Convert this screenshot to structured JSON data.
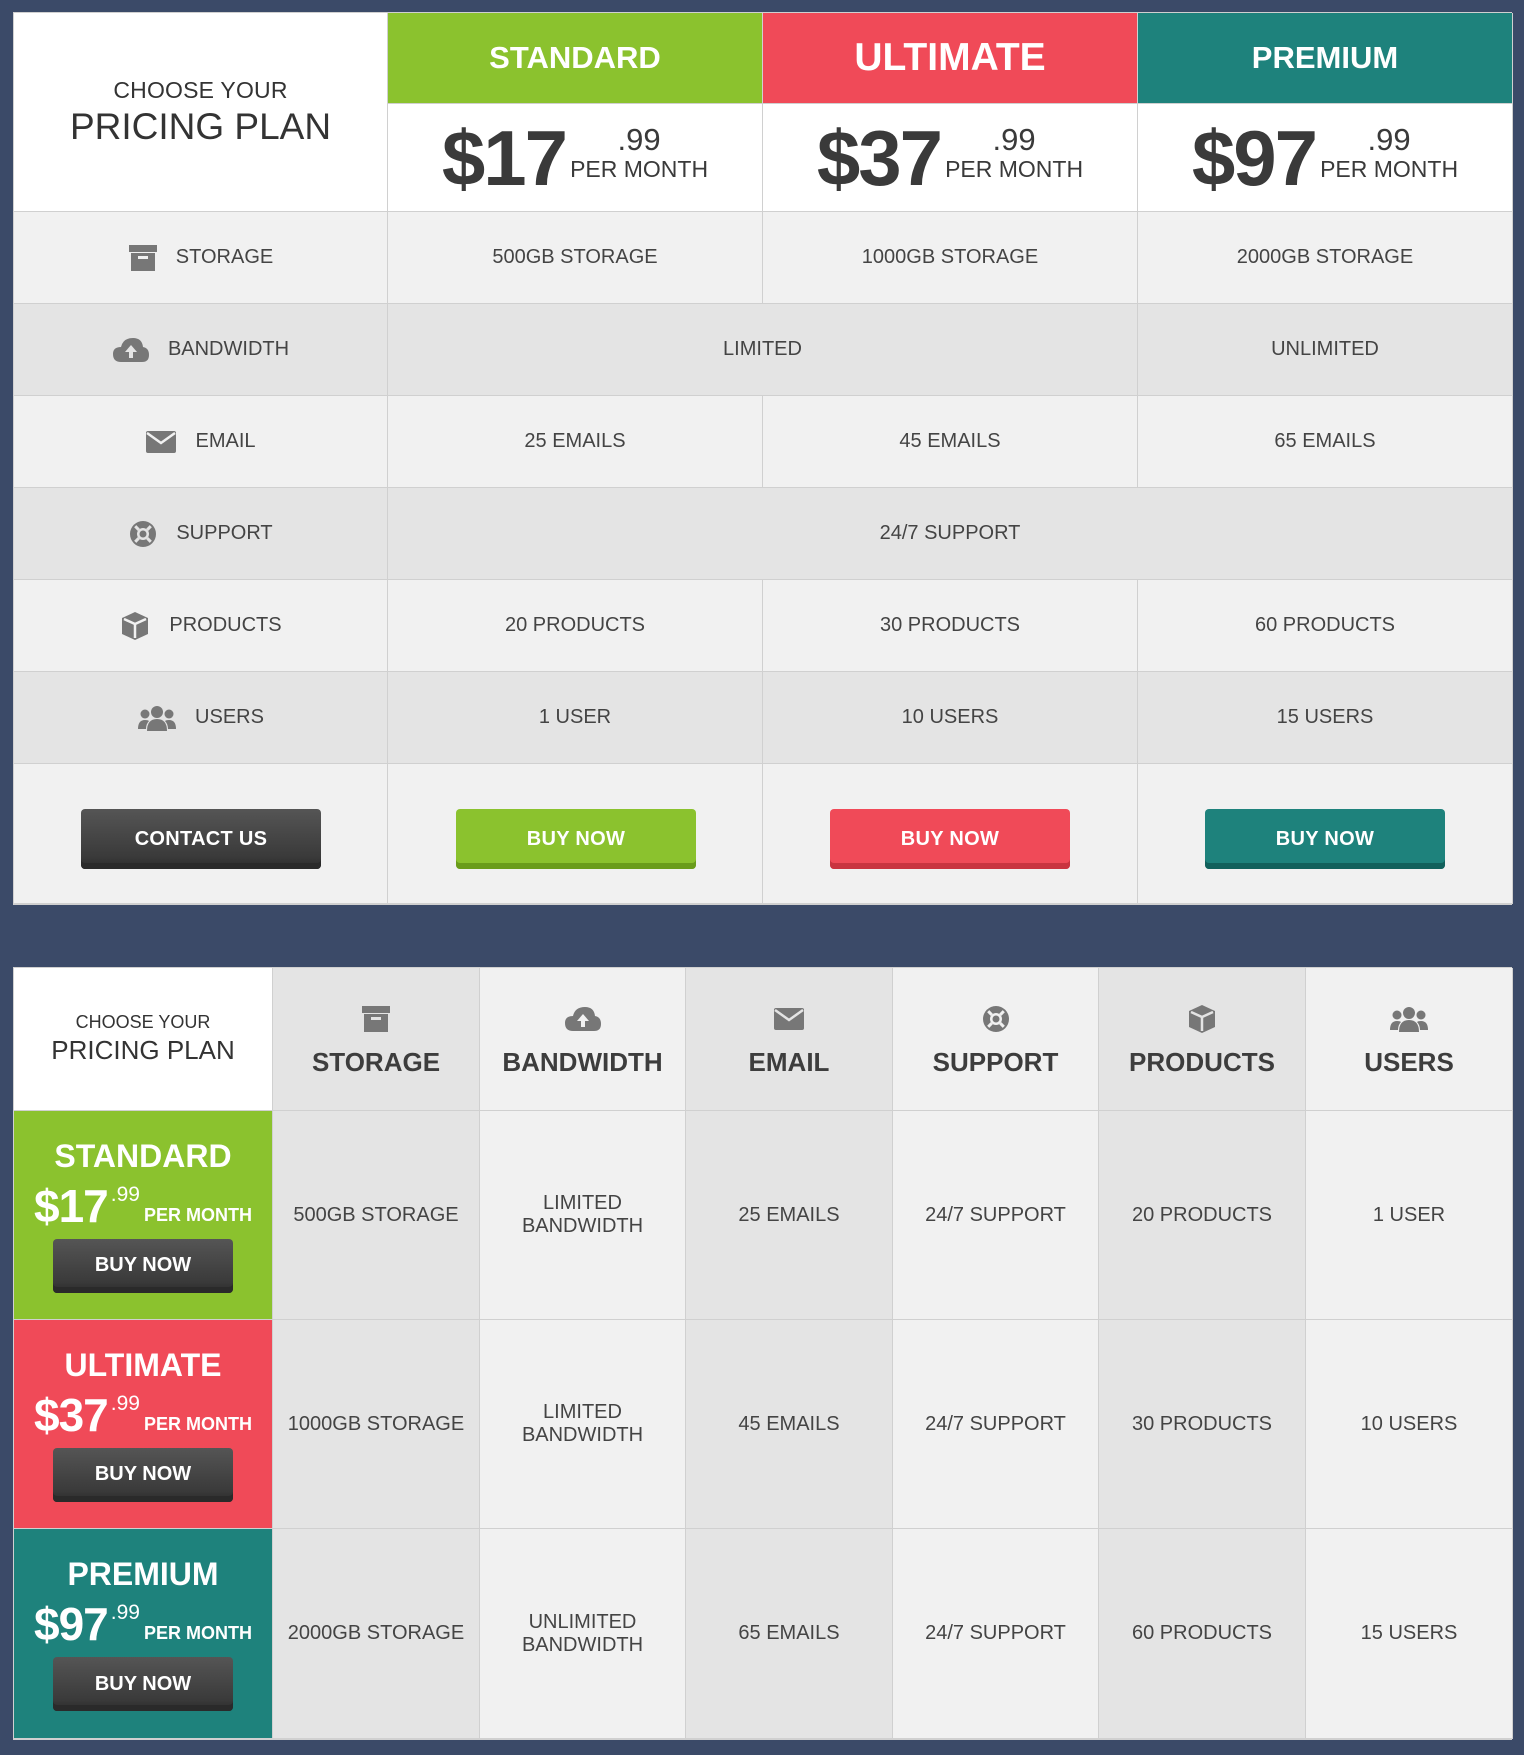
{
  "intro": {
    "top": "CHOOSE YOUR",
    "bottom": "PRICING PLAN"
  },
  "plans": [
    {
      "name": "STANDARD",
      "dollars": "$17",
      "cents": ".99",
      "per": "PER MONTH",
      "color": "#8bc22e",
      "button": "BUY NOW",
      "side_button": "BUY NOW",
      "values": {
        "storage": "500GB STORAGE",
        "email": "25 EMAILS",
        "products": "20 PRODUCTS",
        "users": "1 USER",
        "bandwidth2": "LIMITED BANDWIDTH",
        "support2": "24/7 SUPPORT"
      }
    },
    {
      "name": "ULTIMATE",
      "dollars": "$37",
      "cents": ".99",
      "per": "PER MONTH",
      "color": "#f04a58",
      "button": "BUY NOW",
      "side_button": "BUY NOW",
      "values": {
        "storage": "1000GB STORAGE",
        "email": "45 EMAILS",
        "products": "30 PRODUCTS",
        "users": "10 USERS",
        "bandwidth2": "LIMITED BANDWIDTH",
        "support2": "24/7 SUPPORT"
      }
    },
    {
      "name": "PREMIUM",
      "dollars": "$97",
      "cents": ".99",
      "per": "PER MONTH",
      "color": "#1e827c",
      "button": "BUY NOW",
      "side_button": "BUY NOW",
      "values": {
        "storage": "2000GB STORAGE",
        "email": "65 EMAILS",
        "products": "60 PRODUCTS",
        "users": "15 USERS",
        "bandwidth2": "UNLIMITED BANDWIDTH",
        "support2": "24/7 SUPPORT"
      }
    }
  ],
  "features": {
    "storage": {
      "label": "STORAGE",
      "icon": "archive-icon"
    },
    "bandwidth": {
      "label": "BANDWIDTH",
      "icon": "cloud-upload-icon"
    },
    "email": {
      "label": "EMAIL",
      "icon": "envelope-icon"
    },
    "support": {
      "label": "SUPPORT",
      "icon": "life-ring-icon"
    },
    "products": {
      "label": "PRODUCTS",
      "icon": "cube-icon"
    },
    "users": {
      "label": "USERS",
      "icon": "users-icon"
    }
  },
  "merged": {
    "bandwidth_limited": "LIMITED",
    "bandwidth_unlimited": "UNLIMITED",
    "support_all": "24/7 SUPPORT"
  },
  "contact_button": "CONTACT US"
}
